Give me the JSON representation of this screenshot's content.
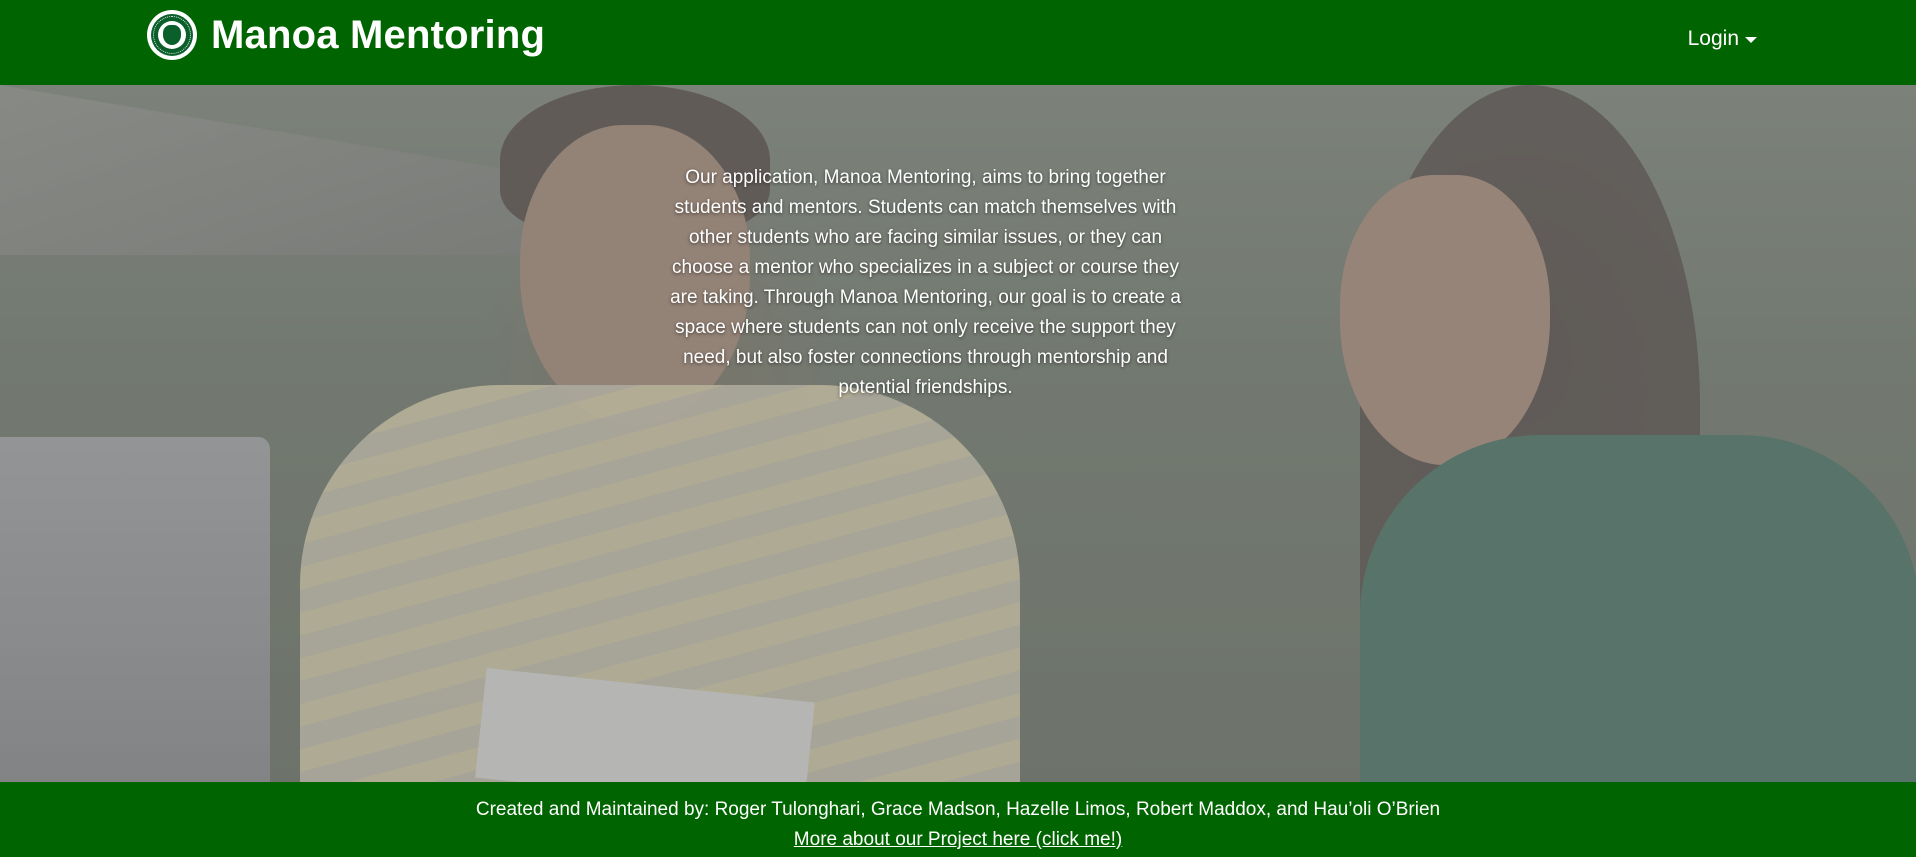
{
  "navbar": {
    "brand_title": "Manoa Mentoring",
    "logo_icon": "university-seal-icon",
    "login_label": "Login",
    "login_icon": "caret-down-icon",
    "bg_color": "#006400"
  },
  "hero": {
    "description": "Our application, Manoa Mentoring, aims to bring together students and mentors. Students can match themselves with other students who are facing similar issues, or they can choose a mentor who specializes in a subject or course they are taking. Through Manoa Mentoring, our goal is to create a space where students can not only receive the support they need, but also foster connections through mentorship and potential friendships."
  },
  "footer": {
    "credits": "Created and Maintained by: Roger Tulonghari, Grace Madson, Hazelle Limos, Robert Maddox, and Hau’oli O’Brien",
    "project_link": "More about our Project here (click me!)",
    "bg_color": "#006400"
  }
}
